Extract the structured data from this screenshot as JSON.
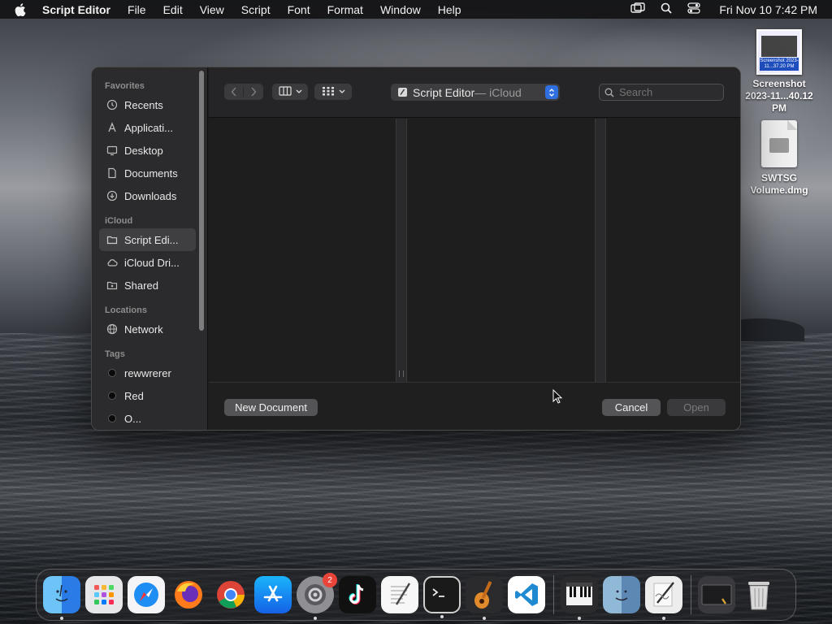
{
  "menubar": {
    "app_name": "Script Editor",
    "items": [
      "File",
      "Edit",
      "View",
      "Script",
      "Font",
      "Format",
      "Window",
      "Help"
    ],
    "clock": "Fri Nov 10  7:42 PM"
  },
  "desktop": {
    "screenshot": {
      "label_line1": "Screenshot",
      "label_line2": "2023-11...40.12 PM",
      "thumb_tag": "Screenshot 2023-11...37.20 PM"
    },
    "dmg": {
      "label_line1": "SWTSG",
      "label_line2": "Volume.dmg"
    }
  },
  "sidebar": {
    "favorites_header": "Favorites",
    "favorites": [
      "Recents",
      "Applicati...",
      "Desktop",
      "Documents",
      "Downloads"
    ],
    "icloud_header": "iCloud",
    "icloud": [
      "Script Edi...",
      "iCloud Dri...",
      "Shared"
    ],
    "locations_header": "Locations",
    "locations": [
      "Network"
    ],
    "tags_header": "Tags",
    "tags": [
      "rewwrerer",
      "Red",
      "O..."
    ]
  },
  "toolbar": {
    "location": "Script Editor",
    "location_suffix": " — iCloud",
    "search_placeholder": "Search"
  },
  "footer": {
    "new_document": "New Document",
    "cancel": "Cancel",
    "open": "Open"
  },
  "dock": {
    "settings_badge": "2"
  },
  "colors": {
    "accent": "#2f6fe0",
    "dialog_bg": "#1e1e1e",
    "sidebar_bg": "#2b2b2d",
    "badge": "#e8443a"
  }
}
